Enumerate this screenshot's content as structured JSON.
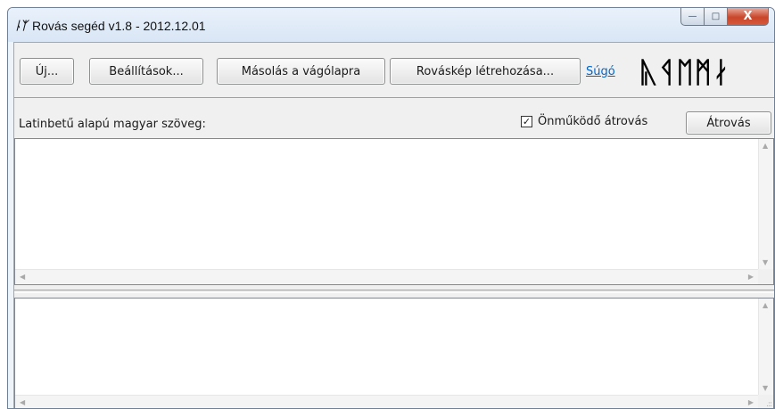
{
  "window": {
    "title": "Rovás segéd v1.8 - 2012.12.01",
    "app_icon": "ᚿᛉ",
    "caption": {
      "minimize": "—",
      "maximize": "□",
      "close": "X"
    }
  },
  "toolbar": {
    "new_label": "Új...",
    "settings_label": "Beállítások...",
    "copy_label": "Másolás a vágólapra",
    "image_label": "Rováskép létrehozása...",
    "help_label": "Súgó",
    "rune_logo": "ᚣᛩᛖᛗᛅ"
  },
  "input_section": {
    "label": "Latinbetű alapú magyar szöveg:",
    "auto_transcribe_label": "Önműködő átrovás",
    "auto_transcribe_checked": true,
    "check_mark": "✓",
    "transcribe_button_label": "Átrovás"
  },
  "input_text": {
    "value": ""
  },
  "output_text": {
    "value": ""
  },
  "icons": {
    "scroll_up": "▲",
    "scroll_down": "▼",
    "scroll_left": "◀",
    "scroll_right": "▶",
    "size_grip": ".::"
  }
}
